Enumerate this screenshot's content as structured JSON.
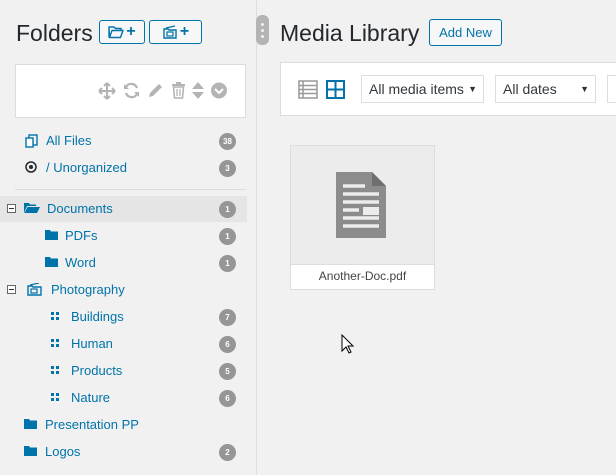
{
  "folders_panel": {
    "title": "Folders",
    "add_folder_plus": "+",
    "add_gallery_plus": "+",
    "toolbar_icons": [
      "move-icon",
      "refresh-icon",
      "edit-icon",
      "trash-icon",
      "sort-icon",
      "chevron-down-circle-icon"
    ],
    "special_items": [
      {
        "label": "All Files",
        "count": "38",
        "icon": "files-icon"
      },
      {
        "label": "/ Unorganized",
        "count": "3",
        "icon": "target-icon"
      }
    ],
    "tree": [
      {
        "label": "Documents",
        "count": "1",
        "icon": "open-folder-icon",
        "selected": true
      },
      {
        "label": "PDFs",
        "count": "1",
        "icon": "folder-icon"
      },
      {
        "label": "Word",
        "count": "1",
        "icon": "folder-icon"
      },
      {
        "label": "Photography",
        "count": "",
        "icon": "gallery-folder-icon"
      },
      {
        "label": "Buildings",
        "count": "7",
        "icon": "gallery-grid-icon"
      },
      {
        "label": "Human",
        "count": "6",
        "icon": "gallery-grid-icon"
      },
      {
        "label": "Products",
        "count": "5",
        "icon": "gallery-grid-icon"
      },
      {
        "label": "Nature",
        "count": "6",
        "icon": "gallery-grid-icon"
      },
      {
        "label": "Presentation PP",
        "count": "",
        "icon": "folder-icon"
      },
      {
        "label": "Logos",
        "count": "2",
        "icon": "folder-icon"
      }
    ]
  },
  "media_library": {
    "title": "Media Library",
    "add_new_label": "Add New",
    "view_modes": [
      "list-view-icon",
      "grid-view-icon"
    ],
    "active_view": "grid",
    "filter_type": {
      "selected": "All media items"
    },
    "filter_date": {
      "selected": "All dates"
    },
    "attachments": [
      {
        "filename": "Another-Doc.pdf",
        "icon": "document-icon"
      }
    ]
  },
  "colors": {
    "accent": "#0073aa",
    "background": "#f1f1f1",
    "badge": "#969696",
    "selected_row": "#e5e5e5"
  }
}
